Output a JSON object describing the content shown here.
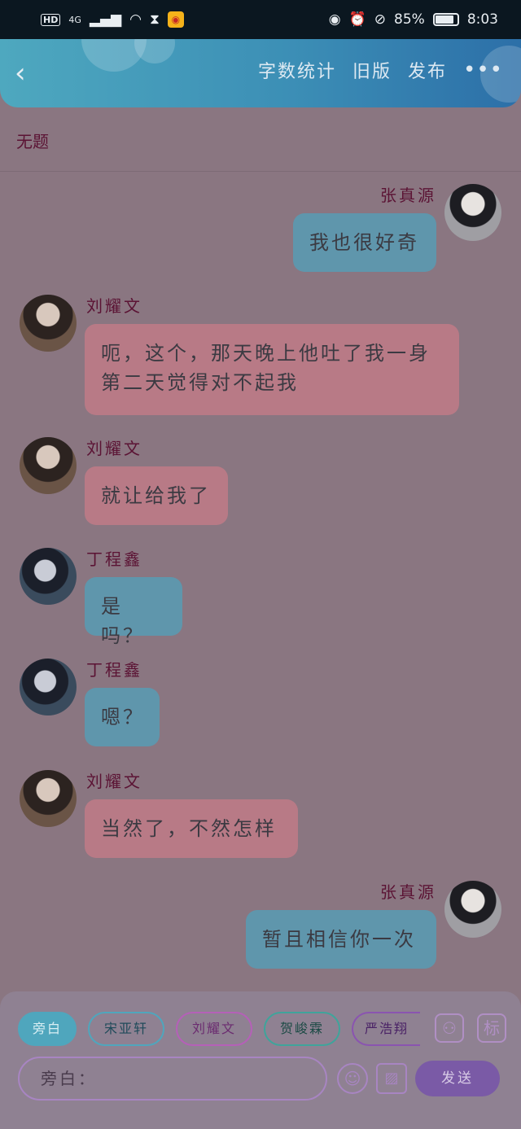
{
  "status_bar": {
    "hd": "HD",
    "network": "4G",
    "battery_pct": "85%",
    "battery_level": 0.85,
    "time": "8:03",
    "icons": [
      "signal-icon",
      "wifi-icon",
      "hourglass-icon",
      "weibo-icon",
      "eye-icon",
      "alarm-icon",
      "mute-icon",
      "battery-icon"
    ]
  },
  "header": {
    "back_icon": "chevron-left-icon",
    "word_count": "字数统计",
    "old_version": "旧版",
    "publish": "发布",
    "more": "•••"
  },
  "doc": {
    "title": "无题"
  },
  "messages": [
    {
      "speaker": "张真源",
      "side": "right",
      "bubble": "blue",
      "text": "我也很好奇"
    },
    {
      "speaker": "刘耀文",
      "side": "left",
      "bubble": "pink",
      "lines": [
        "呃，这个，那天晚上他吐了我一身",
        "第二天觉得对不起我"
      ]
    },
    {
      "speaker": "刘耀文",
      "side": "left",
      "bubble": "pink",
      "text": "就让给我了"
    },
    {
      "speaker": "丁程鑫",
      "side": "left",
      "bubble": "blue",
      "text": "是吗？"
    },
    {
      "speaker": "丁程鑫",
      "side": "left",
      "bubble": "blue",
      "text": "嗯？"
    },
    {
      "speaker": "刘耀文",
      "side": "left",
      "bubble": "pink",
      "text": "当然了，不然怎样"
    },
    {
      "speaker": "张真源",
      "side": "right",
      "bubble": "blue",
      "text": "暂且相信你一次"
    }
  ],
  "characters": [
    "旁白",
    "宋亚轩",
    "刘耀文",
    "贺峻霖",
    "严浩翔"
  ],
  "colors": {
    "narration_chip": "#4fa6bd",
    "songyaxuan": "#4fa6bd",
    "liuyaowen": "#b560b8",
    "hejunlin": "#3fa49b",
    "yanhaoxiang": "#8a54b0",
    "pink_bubble": "#b87a86",
    "blue_bubble": "#5f96ac"
  },
  "toolbar": {
    "avatar_btn_icon": "person-icon",
    "tag_btn": "标",
    "input_placeholder": "旁白：",
    "emoji_icon": "smile-icon",
    "image_icon": "image-icon",
    "send": "发送"
  }
}
